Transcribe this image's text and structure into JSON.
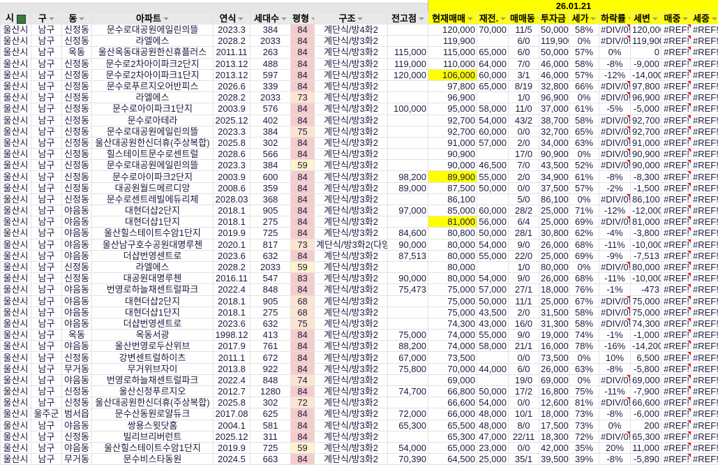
{
  "date_header": "26.01.21",
  "columns": [
    "시",
    "구",
    "동",
    "아파트",
    "연식",
    "세대수",
    "평형",
    "구조",
    "전고점",
    "현재매매",
    "재전.",
    "매매동",
    "투자금",
    "세가",
    "하락률",
    "세변",
    "매중",
    "세중"
  ],
  "highlighted_current_price_rows": [
    4,
    13,
    17
  ],
  "colors": {
    "highlight": "#ffff00",
    "pyeong_84": "#f4cccc",
    "pyeong_mid": "#fce4d0",
    "pyeong_59": "#fff2cc"
  },
  "rows": [
    [
      "울산시",
      "남구",
      "신정동",
      "문수로대공원에일린의뜰",
      "2023.3",
      "384",
      "84",
      "계단식/방4화2",
      "",
      "120,000",
      "70,000",
      "11/5",
      "50,000",
      "58%",
      "#DIV/0!",
      "120,000",
      "#REF!",
      "#REF!"
    ],
    [
      "울산시",
      "남구",
      "신정동",
      "라엘에스",
      "2028.2",
      "2033",
      "84",
      "계단식/방3화2",
      "",
      "119,900",
      "",
      "6/0",
      "119,900",
      "0%",
      "#DIV/0!",
      "119,900",
      "#REF!",
      "#REF!"
    ],
    [
      "울산시",
      "남구",
      "옥동",
      "울산옥동대공원한신휴플러스",
      "2011.11",
      "263",
      "84",
      "계단식/방3화2",
      "115,000",
      "115,000",
      "65,000",
      "6/0",
      "50,000",
      "57%",
      "0%",
      "0",
      "#REF!",
      "#REF!"
    ],
    [
      "울산시",
      "남구",
      "신정동",
      "문수로2차아이파크2단지",
      "2013.12",
      "488",
      "84",
      "계단식/방3화2",
      "119,000",
      "110,000",
      "64,000",
      "7/0",
      "46,000",
      "58%",
      "-8%",
      "-9,000",
      "#REF!",
      "#REF!"
    ],
    [
      "울산시",
      "남구",
      "신정동",
      "문수로2차아이파크1단지",
      "2013.12",
      "597",
      "84",
      "계단식/방3화2",
      "120,000",
      "106,000",
      "60,000",
      "3/1",
      "46,000",
      "57%",
      "-12%",
      "-14,000",
      "#REF!",
      "#REF!"
    ],
    [
      "울산시",
      "남구",
      "신정동",
      "문수로푸르지오어반피스",
      "2026.6",
      "339",
      "84",
      "계단식/방3화2",
      "",
      "97,800",
      "65,000",
      "8/19",
      "32,800",
      "66%",
      "#DIV/0!",
      "97,800",
      "#REF!",
      "#REF!"
    ],
    [
      "울산시",
      "남구",
      "신정동",
      "라엘에스",
      "2028.2",
      "2033",
      "73",
      "계단식/방3화2",
      "",
      "96,900",
      "",
      "1/0",
      "96,900",
      "0%",
      "#DIV/0!",
      "96,900",
      "#REF!",
      "#REF!"
    ],
    [
      "울산시",
      "남구",
      "신정동",
      "문수로아이파크1단지",
      "2003.9",
      "576",
      "84",
      "계단식/방3화2",
      "100,000",
      "95,000",
      "58,000",
      "11/0",
      "37,000",
      "61%",
      "-5%",
      "-5,000",
      "#REF!",
      "#REF!"
    ],
    [
      "울산시",
      "남구",
      "신정동",
      "문수로아테라",
      "2025.12",
      "402",
      "84",
      "계단식/방3화2",
      "",
      "92,700",
      "54,000",
      "43/2",
      "38,700",
      "58%",
      "#DIV/0!",
      "92,700",
      "#REF!",
      "#REF!"
    ],
    [
      "울산시",
      "남구",
      "신정동",
      "문수로대공원에일린의뜰",
      "2023.3",
      "384",
      "75",
      "계단식/방3화2",
      "",
      "92,700",
      "60,000",
      "0/0",
      "32,700",
      "65%",
      "#DIV/0!",
      "92,700",
      "#REF!",
      "#REF!"
    ],
    [
      "울산시",
      "남구",
      "신정동",
      "울산대공원한신더휴(주상복합)",
      "2025.8",
      "302",
      "84",
      "계단식/방3화2",
      "",
      "91,000",
      "57,000",
      "2/0",
      "34,000",
      "63%",
      "#DIV/0!",
      "91,000",
      "#REF!",
      "#REF!"
    ],
    [
      "울산시",
      "남구",
      "신정동",
      "힐스테이트문수로센트럴",
      "2028.6",
      "566",
      "84",
      "계단식/방3화2",
      "",
      "90,900",
      "",
      "17/0",
      "90,900",
      "0%",
      "#DIV/0!",
      "90,900",
      "#REF!",
      "#REF!"
    ],
    [
      "울산시",
      "남구",
      "신정동",
      "문수로대공원에일린의뜰",
      "2023.3",
      "384",
      "59",
      "계단식/방3화2",
      "",
      "90,000",
      "46,500",
      "7/0",
      "43,500",
      "52%",
      "#DIV/0!",
      "90,000",
      "#REF!",
      "#REF!"
    ],
    [
      "울산시",
      "남구",
      "신정동",
      "문수로아이파크2단지",
      "2003.9",
      "600",
      "84",
      "계단식/방3화2",
      "98,200",
      "89,900",
      "55,000",
      "2/0",
      "34,900",
      "61%",
      "-8%",
      "-8,300",
      "#REF!",
      "#REF!"
    ],
    [
      "울산시",
      "남구",
      "신정동",
      "대공원월드메르디앙",
      "2008.6",
      "359",
      "84",
      "계단식/방3화2",
      "89,000",
      "87,500",
      "50,000",
      "0/0",
      "37,500",
      "57%",
      "-2%",
      "-1,500",
      "#REF!",
      "#REF!"
    ],
    [
      "울산시",
      "남구",
      "신정동",
      "문수로센트레빌에듀리체",
      "2028.03",
      "368",
      "84",
      "계단식/방3화2",
      "",
      "86,100",
      "",
      "5/0",
      "86,100",
      "0%",
      "#DIV/0!",
      "86,100",
      "#REF!",
      "#REF!"
    ],
    [
      "울산시",
      "남구",
      "야음동",
      "대현더샵2단지",
      "2018.1",
      "905",
      "84",
      "계단식/방3화2",
      "97,000",
      "85,000",
      "60,000",
      "28/2",
      "25,000",
      "71%",
      "-12%",
      "-12,000",
      "#REF!",
      "#REF!"
    ],
    [
      "울산시",
      "남구",
      "야음동",
      "대현더샵1단지",
      "2018.1",
      "275",
      "84",
      "계단식/방3화2",
      "",
      "81,000",
      "56,000",
      "6/4",
      "25,000",
      "69%",
      "#DIV/0!",
      "81,000",
      "#REF!",
      "#REF!"
    ],
    [
      "울산시",
      "남구",
      "야음동",
      "울산힐스테이트수암1단지",
      "2019.9",
      "725",
      "84",
      "계단식/방3화2",
      "84,600",
      "80,800",
      "50,000",
      "28/1",
      "30,800",
      "62%",
      "-4%",
      "-3,800",
      "#REF!",
      "#REF!"
    ],
    [
      "울산시",
      "남구",
      "야음동",
      "울산남구호수공원대명루첸",
      "2020.1",
      "817",
      "73",
      "계단식/방3화2(다양",
      "90,000",
      "80,000",
      "54,000",
      "9/0",
      "26,000",
      "68%",
      "-11%",
      "-10,000",
      "#REF!",
      "#REF!"
    ],
    [
      "울산시",
      "남구",
      "야음동",
      "더샵번영센트로",
      "2023.6",
      "632",
      "84",
      "계단식/방3화2",
      "87,513",
      "80,000",
      "55,000",
      "22/0",
      "25,000",
      "69%",
      "-9%",
      "-7,513",
      "#REF!",
      "#REF!"
    ],
    [
      "울산시",
      "남구",
      "신정동",
      "라엘에스",
      "2028.2",
      "2033",
      "59",
      "계단식/방3화2",
      "",
      "80,000",
      "",
      "1/0",
      "80,000",
      "0%",
      "#DIV/0!",
      "80,000",
      "#REF!",
      "#REF!"
    ],
    [
      "울산시",
      "남구",
      "신정동",
      "대공원대명루첸",
      "2016.11",
      "547",
      "83",
      "계단식/방3화2",
      "90,000",
      "80,000",
      "54,000",
      "9/0",
      "26,000",
      "68%",
      "-11%",
      "-10,000",
      "#REF!",
      "#REF!"
    ],
    [
      "울산시",
      "남구",
      "야음동",
      "번영로하늘채센트럴파크",
      "2022.4",
      "848",
      "84",
      "계단식/방3화2",
      "75,473",
      "75,000",
      "57,000",
      "27/1",
      "18,000",
      "76%",
      "-1%",
      "-473",
      "#REF!",
      "#REF!"
    ],
    [
      "울산시",
      "남구",
      "야음동",
      "대현더샵2단지",
      "2018.1",
      "905",
      "68",
      "계단식/방3화2",
      "",
      "75,000",
      "50,000",
      "11/1",
      "25,000",
      "67%",
      "#DIV/0!",
      "75,000",
      "#REF!",
      "#REF!"
    ],
    [
      "울산시",
      "남구",
      "야음동",
      "대현더샵1단지",
      "2018.1",
      "275",
      "68",
      "계단식/방3화2",
      "",
      "75,000",
      "43,500",
      "2/0",
      "31,500",
      "58%",
      "#DIV/0!",
      "75,000",
      "#REF!",
      "#REF!"
    ],
    [
      "울산시",
      "남구",
      "야음동",
      "더샵번영센트로",
      "2023.6",
      "632",
      "75",
      "계단식/방3화2",
      "",
      "74,300",
      "43,000",
      "16/0",
      "31,300",
      "58%",
      "#DIV/0!",
      "74,300",
      "#REF!",
      "#REF!"
    ],
    [
      "울산시",
      "남구",
      "옥동",
      "옥동서광",
      "1998.12",
      "413",
      "84",
      "계단식/방3화2",
      "75,000",
      "74,000",
      "55,000",
      "9/0",
      "19,000",
      "74%",
      "-1%",
      "-1,000",
      "#REF!",
      "#REF!"
    ],
    [
      "울산시",
      "남구",
      "야음동",
      "울산번영로두산위브",
      "2017.9",
      "761",
      "84",
      "계단식/방3화2",
      "88,200",
      "74,000",
      "58,000",
      "21/1",
      "16,000",
      "78%",
      "-16%",
      "-14,200",
      "#REF!",
      "#REF!"
    ],
    [
      "울산시",
      "남구",
      "신정동",
      "강변센트럴하이츠",
      "2011.1",
      "672",
      "84",
      "계단식/방3화2",
      "67,000",
      "73,500",
      "",
      "0/0",
      "73,500",
      "0%",
      "10%",
      "6,500",
      "#REF!",
      "#REF!"
    ],
    [
      "울산시",
      "남구",
      "무거동",
      "무거위브자이",
      "2013.8",
      "922",
      "84",
      "계단식/방3화2",
      "75,800",
      "70,000",
      "44,000",
      "6/0",
      "26,000",
      "63%",
      "-8%",
      "-5,800",
      "#REF!",
      "#REF!"
    ],
    [
      "울산시",
      "남구",
      "야음동",
      "번영로하늘채센트럴파크",
      "2022.4",
      "848",
      "74",
      "계단식/방3화2",
      "",
      "69,000",
      "",
      "19/0",
      "69,000",
      "0%",
      "#DIV/0!",
      "69,000",
      "#REF!",
      "#REF!"
    ],
    [
      "울산시",
      "남구",
      "신정동",
      "울산신정푸르지오",
      "2012.7",
      "1280",
      "84",
      "계단식/방3화2",
      "74,700",
      "66,800",
      "50,000",
      "17/2",
      "16,800",
      "75%",
      "-11%",
      "-7,900",
      "#REF!",
      "#REF!"
    ],
    [
      "울산시",
      "남구",
      "신정동",
      "울산대공원한신더휴(주상복합)",
      "2025.8",
      "302",
      "72",
      "계단식/방3화2",
      "",
      "66,600",
      "54,000",
      "0/0",
      "12,600",
      "81%",
      "#DIV/0!",
      "66,600",
      "#REF!",
      "#REF!"
    ],
    [
      "울산시",
      "울주군",
      "범서읍",
      "문수산동원로얄듀크",
      "2017.08",
      "625",
      "84",
      "계단식/방3화2",
      "72,000",
      "66,000",
      "48,000",
      "10/1",
      "18,000",
      "73%",
      "-8%",
      "-6,000",
      "#REF!",
      "#REF!"
    ],
    [
      "울산시",
      "남구",
      "야음동",
      "쌍용스윗닷홈",
      "2004.1",
      "581",
      "84",
      "계단식/방3화2",
      "65,300",
      "65,500",
      "48,000",
      "8/0",
      "17,500",
      "73%",
      "0%",
      "200",
      "#REF!",
      "#REF!"
    ],
    [
      "울산시",
      "남구",
      "신정동",
      "빌리브리버런트",
      "2025.12",
      "311",
      "84",
      "계단식/방3화2",
      "",
      "65,300",
      "47,000",
      "22/11",
      "18,300",
      "72%",
      "#DIV/0!",
      "65,300",
      "#REF!",
      "#REF!"
    ],
    [
      "울산시",
      "남구",
      "야음동",
      "울산힐스테이트수암1단지",
      "2019.9",
      "725",
      "59",
      "계단식/방3화2",
      "54,000",
      "65,000",
      "23,000",
      "0/0",
      "42,000",
      "35%",
      "20%",
      "11,000",
      "#REF!",
      "#REF!"
    ],
    [
      "울산시",
      "남구",
      "무거동",
      "문수비스타동원",
      "2024.5",
      "663",
      "84",
      "계단식/방3화2",
      "70,390",
      "64,500",
      "25,000",
      "35/1",
      "39,500",
      "39%",
      "-8%",
      "-5,890",
      "#REF!",
      "#REF!"
    ]
  ]
}
